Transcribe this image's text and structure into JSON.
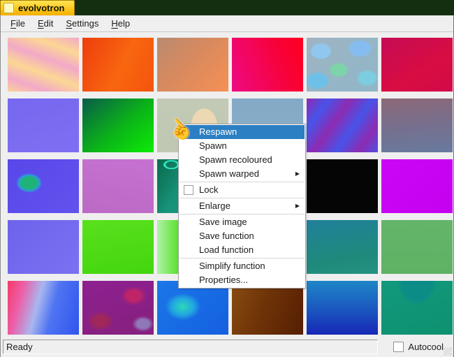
{
  "window": {
    "title": "evolvotron",
    "desktop_color": "#142f10",
    "tab_color_top": "#ffe456",
    "tab_color_bottom": "#f3ae00"
  },
  "menubar": {
    "items": [
      {
        "id": "file",
        "key": "F",
        "rest": "ile"
      },
      {
        "id": "edit",
        "key": "E",
        "rest": "dit"
      },
      {
        "id": "settings",
        "key": "S",
        "rest": "ettings"
      },
      {
        "id": "help",
        "key": "H",
        "rest": "elp"
      }
    ]
  },
  "grid": {
    "rows": 5,
    "cols": 6,
    "tiles": [
      {
        "id": "r1c1",
        "name": "peach-pink-diagonal-stripes",
        "bg": "repeating-linear-gradient(200deg, #f2a9c8 0px, #fcd794 22px, #f2a9c8 44px)"
      },
      {
        "id": "r1c2",
        "name": "orange-red-gradient",
        "bg": "linear-gradient(115deg, #ee3d0e, #f8660f 55%, #f4540d)"
      },
      {
        "id": "r1c3",
        "name": "tan-salmon-gradient",
        "bg": "linear-gradient(135deg, #b98a70, #d88a5e 45%, #f69055)"
      },
      {
        "id": "r1c4",
        "name": "magenta-red-gradient",
        "bg": "linear-gradient(70deg, #ee0a84, #f80136 70%, #fe0022)"
      },
      {
        "id": "r1c5",
        "name": "blue-green-mottled-pattern",
        "bg": "radial-gradient(26px 20px at 20% 25%, #8fc7ee 0 50%, rgba(0,0,0,0) 60%), radial-gradient(30px 22px at 75% 20%, #86bdf0 0 45%, rgba(0,0,0,0) 60%), radial-gradient(24px 18px at 45% 60%, #7dd4a8 0 45%, rgba(0,0,0,0) 60%), radial-gradient(30px 22px at 15% 80%, #6fc0e8 0 45%, rgba(0,0,0,0) 60%), radial-gradient(26px 20px at 85% 75%, #7ccde0 0 45%, rgba(0,0,0,0) 60%), linear-gradient(135deg, #9fb4c2, #8fb6c8)"
      },
      {
        "id": "r1c6",
        "name": "crimson-gradient",
        "bg": "linear-gradient(150deg, #c60b55, #d80d42 60%, #d2094a)"
      },
      {
        "id": "r2c1",
        "name": "periwinkle-violet",
        "bg": "linear-gradient(165deg, #7668ef, #7e6ff2)"
      },
      {
        "id": "r2c2",
        "name": "dark-to-bright-green-gradient",
        "bg": "linear-gradient(140deg, #0a5c49, #0bb517 55%, #0ceb06)"
      },
      {
        "id": "r2c3",
        "name": "sage-with-peach-dome",
        "bg": "radial-gradient(19px 26px at 66% 52%, #ecd8b2 0 98%, rgba(0,0,0,0) 100%), linear-gradient(180deg, #c2cab6, #bfc8b2)"
      },
      {
        "id": "r2c4",
        "name": "steel-blue",
        "bg": "linear-gradient(180deg, #84a9c6, #8aafc9)"
      },
      {
        "id": "r2c5",
        "name": "blue-purple-diagonal-stripes",
        "bg": "repeating-linear-gradient(125deg, #8d2bb2 0px, #4853e8 26px, #8d2bb2 52px)"
      },
      {
        "id": "r2c6",
        "name": "mauve-slate-gradient",
        "bg": "linear-gradient(175deg, #8c6878 0%, #75708f 55%, #687a9e 100%)"
      },
      {
        "id": "r3c1",
        "name": "blue-violet-with-green-blob",
        "bg": "radial-gradient(24px 18px at 30% 44%, #1fb378 0 45%, #2e9ad8 62%, rgba(88,70,232,0) 78%), linear-gradient(135deg, #5847e9, #6253ee)"
      },
      {
        "id": "r3c2",
        "name": "orchid-gradient",
        "bg": "linear-gradient(190deg, #c671d2, #bb6ac4)"
      },
      {
        "id": "r3c3",
        "name": "teal-with-cyan-squiggle",
        "bg": "radial-gradient(14px 8px at 20% 10%, rgba(0,0,0,0) 55%, #2fe9c4 62% 78%, rgba(0,0,0,0) 84%), linear-gradient(115deg, #0b6b50 0%, rgba(11,107,80,0) 35%), linear-gradient(250deg, #0c7258 0%, rgba(12,114,88,0) 40%), linear-gradient(180deg, #13896c, #18957c)"
      },
      {
        "id": "r3c4",
        "name": "obscured-by-menu",
        "bg": "#9a9a9a"
      },
      {
        "id": "r3c5",
        "name": "black",
        "bg": "#050505"
      },
      {
        "id": "r3c6",
        "name": "bright-magenta",
        "bg": "linear-gradient(135deg, #cb06f6, #c400ef)"
      },
      {
        "id": "r4c1",
        "name": "periwinkle-blue",
        "bg": "linear-gradient(135deg, #6d63ec, #7b71f2)"
      },
      {
        "id": "r4c2",
        "name": "chartreuse-green",
        "bg": "linear-gradient(170deg, #5ae01e, #43d60e)"
      },
      {
        "id": "r4c3",
        "name": "green-with-light-left-edge",
        "bg": "linear-gradient(90deg, #b2f2a6 0%, #4ade18 35%, #2fd00c 100%)"
      },
      {
        "id": "r4c4",
        "name": "obscured-by-menu",
        "bg": "#9a9a9a"
      },
      {
        "id": "r4c5",
        "name": "teal-gradient",
        "bg": "linear-gradient(170deg, #20809a, #1f8a7b 70%, #259381)"
      },
      {
        "id": "r4c6",
        "name": "medium-green",
        "bg": "linear-gradient(180deg, #64b56a, #5fb164)"
      },
      {
        "id": "r5c1",
        "name": "pink-to-blue-swirl",
        "bg": "linear-gradient(105deg, #f53a68 0%, #ec5fa8 20%, #a9b6f0 42%, #4f74f2 62%, #2f55ee 100%)"
      },
      {
        "id": "r5c2",
        "name": "purple-magenta-mottled",
        "bg": "radial-gradient(26px 20px at 72% 28%, #c02468 0 35%, rgba(0,0,0,0) 70%), radial-gradient(30px 22px at 25% 75%, #a12758 0 30%, rgba(0,0,0,0) 65%), radial-gradient(22px 16px at 85% 80%, #8f78b8 0 40%, rgba(0,0,0,0) 70%), linear-gradient(160deg, #8d2090, #86207e)"
      },
      {
        "id": "r5c3",
        "name": "blue-with-cyan-glow",
        "bg": "radial-gradient(34px 26px at 36% 48%, #2bd9b8 0%, #22a8e0 45%, rgba(20,101,229,0) 75%), linear-gradient(135deg, #1b77e8, #155fe0)"
      },
      {
        "id": "r5c4",
        "name": "brown-gradient",
        "bg": "linear-gradient(110deg, #8a4c12 0%, #6e3307 45%, #561f03 100%)"
      },
      {
        "id": "r5c5",
        "name": "sky-to-deep-blue-gradient",
        "bg": "linear-gradient(180deg, #1e86c6 0%, #1b55c0 55%, #1627b5 100%)"
      },
      {
        "id": "r5c6",
        "name": "emerald-with-teal-dome",
        "bg": "radial-gradient(40px 50px at 50% 0%, #0c8c86 0 55%, rgba(0,0,0,0) 70%), linear-gradient(160deg, #12997c, #0d9170)"
      }
    ]
  },
  "context_menu": {
    "highlight_color": "#2b7fc2",
    "items": [
      {
        "label": "Respawn",
        "highlighted": true
      },
      {
        "label": "Spawn"
      },
      {
        "label": "Spawn recoloured"
      },
      {
        "label": "Spawn warped",
        "submenu": true
      },
      {
        "separator": true
      },
      {
        "label": "Lock",
        "checkbox": true,
        "checked": false
      },
      {
        "separator": true
      },
      {
        "label": "Enlarge",
        "submenu": true
      },
      {
        "separator": true
      },
      {
        "label": "Save image"
      },
      {
        "label": "Save function"
      },
      {
        "label": "Load function"
      },
      {
        "separator": true
      },
      {
        "label": "Simplify function"
      },
      {
        "label": "Properties..."
      }
    ],
    "submenu_arrow_icon": "▶"
  },
  "statusbar": {
    "message": "Ready",
    "autocool_label": "Autocool",
    "autocool_checked": false
  },
  "cursor": {
    "glyph": "☝"
  }
}
